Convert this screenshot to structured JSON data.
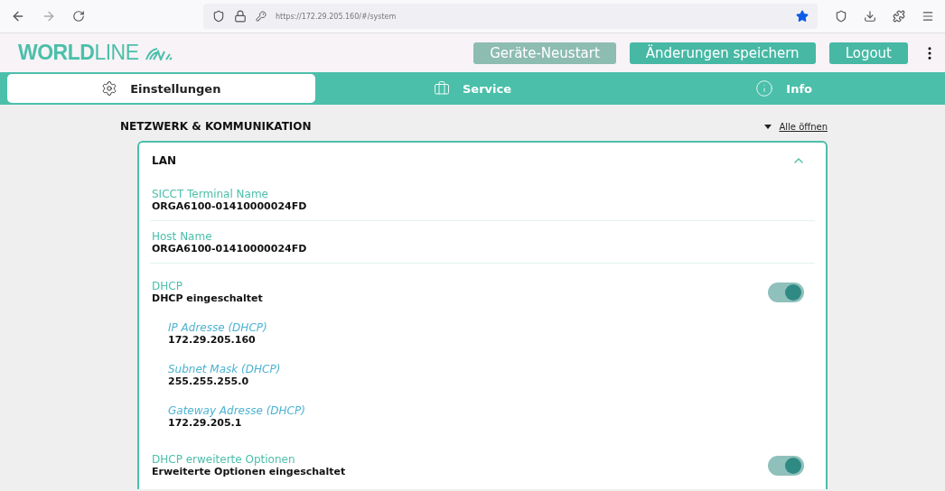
{
  "browser": {
    "url": "https://172.29.205.160/#/system",
    "bookmarked": true
  },
  "header": {
    "logo_bold": "WORLD",
    "logo_light": "LINE",
    "buttons": [
      {
        "label": "Geräte-Neustart",
        "disabled": true
      },
      {
        "label": "Änderungen speichern",
        "disabled": false
      },
      {
        "label": "Logout",
        "disabled": false
      }
    ]
  },
  "tabs": [
    {
      "label": "Einstellungen",
      "selected": true
    },
    {
      "label": "Service",
      "selected": false
    },
    {
      "label": "Info",
      "selected": false
    }
  ],
  "section": {
    "title": "NETZWERK & KOMMUNIKATION",
    "expand_all": "Alle öffnen"
  },
  "card": {
    "title": "LAN",
    "expanded": true,
    "rows": [
      {
        "kind": "text",
        "label": "SICCT Terminal Name",
        "value": "ORGA6100-01410000024FD"
      },
      {
        "kind": "text",
        "label": "Host Name",
        "value": "ORGA6100-01410000024FD"
      },
      {
        "kind": "toggle",
        "label": "DHCP",
        "value": "DHCP eingeschaltet",
        "on": true
      },
      {
        "kind": "sub",
        "label": "IP Adresse (DHCP)",
        "value": "172.29.205.160"
      },
      {
        "kind": "sub",
        "label": "Subnet Mask (DHCP)",
        "value": "255.255.255.0"
      },
      {
        "kind": "sub",
        "label": "Gateway Adresse (DHCP)",
        "value": "172.29.205.1"
      },
      {
        "kind": "toggle",
        "label": "DHCP erweiterte Optionen",
        "value": "Erweiterte Optionen eingeschaltet",
        "on": true
      }
    ]
  }
}
